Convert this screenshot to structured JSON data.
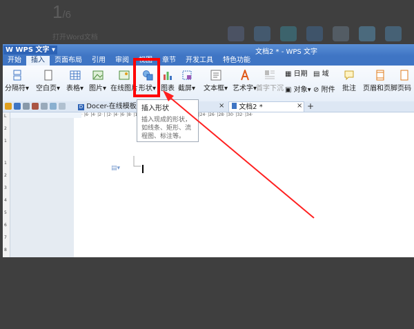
{
  "tutorial": {
    "step_current": "1",
    "step_total": "/6",
    "step_text": "打开Word文档"
  },
  "window": {
    "app_menu_label": "WPS 文字",
    "doc_title": "文档2 * - WPS 文字"
  },
  "menu": {
    "items": [
      "开始",
      "插入",
      "页面布局",
      "引用",
      "审阅",
      "视图",
      "章节",
      "开发工具",
      "特色功能"
    ],
    "active_index": 1
  },
  "ribbon": {
    "page_break": "分隔符",
    "blank_page": "空白页",
    "table": "表格",
    "picture": "图片",
    "online_picture": "在线图片",
    "shape": "形状",
    "chart": "图表",
    "screenshot": "截屏",
    "textbox": "文本框",
    "wordart": "艺术字",
    "first_sink": "首字下沉",
    "date": "日期",
    "field": "域",
    "object": "对象",
    "attachment": "附件",
    "comment": "批注",
    "header_footer": "页眉和页脚",
    "page_number": "页码"
  },
  "tabs": {
    "docer_label": "Docer-在线模板",
    "doc_label": "文档2 *",
    "close_glyph": "×",
    "new_tab_glyph": "+"
  },
  "tooltip": {
    "title": "插入形状",
    "body": "插入现成的形状，如线条、矩形、流程图、标注等。"
  },
  "ruler": {
    "top_ticks": "· |6· |4· |2· |   |2· |4· |6· |8· |10· |12· |14· |16· |18· |20· |22· |24· |26· |28· |30· |32· |34·",
    "left_ticks": [
      "L",
      "2",
      "1",
      "1",
      "2",
      "3",
      "4",
      "5",
      "6",
      "7",
      "8"
    ]
  },
  "colors": {
    "accent": "#3f75c4",
    "highlight": "#ff0000",
    "arrow": "#ff2020"
  }
}
